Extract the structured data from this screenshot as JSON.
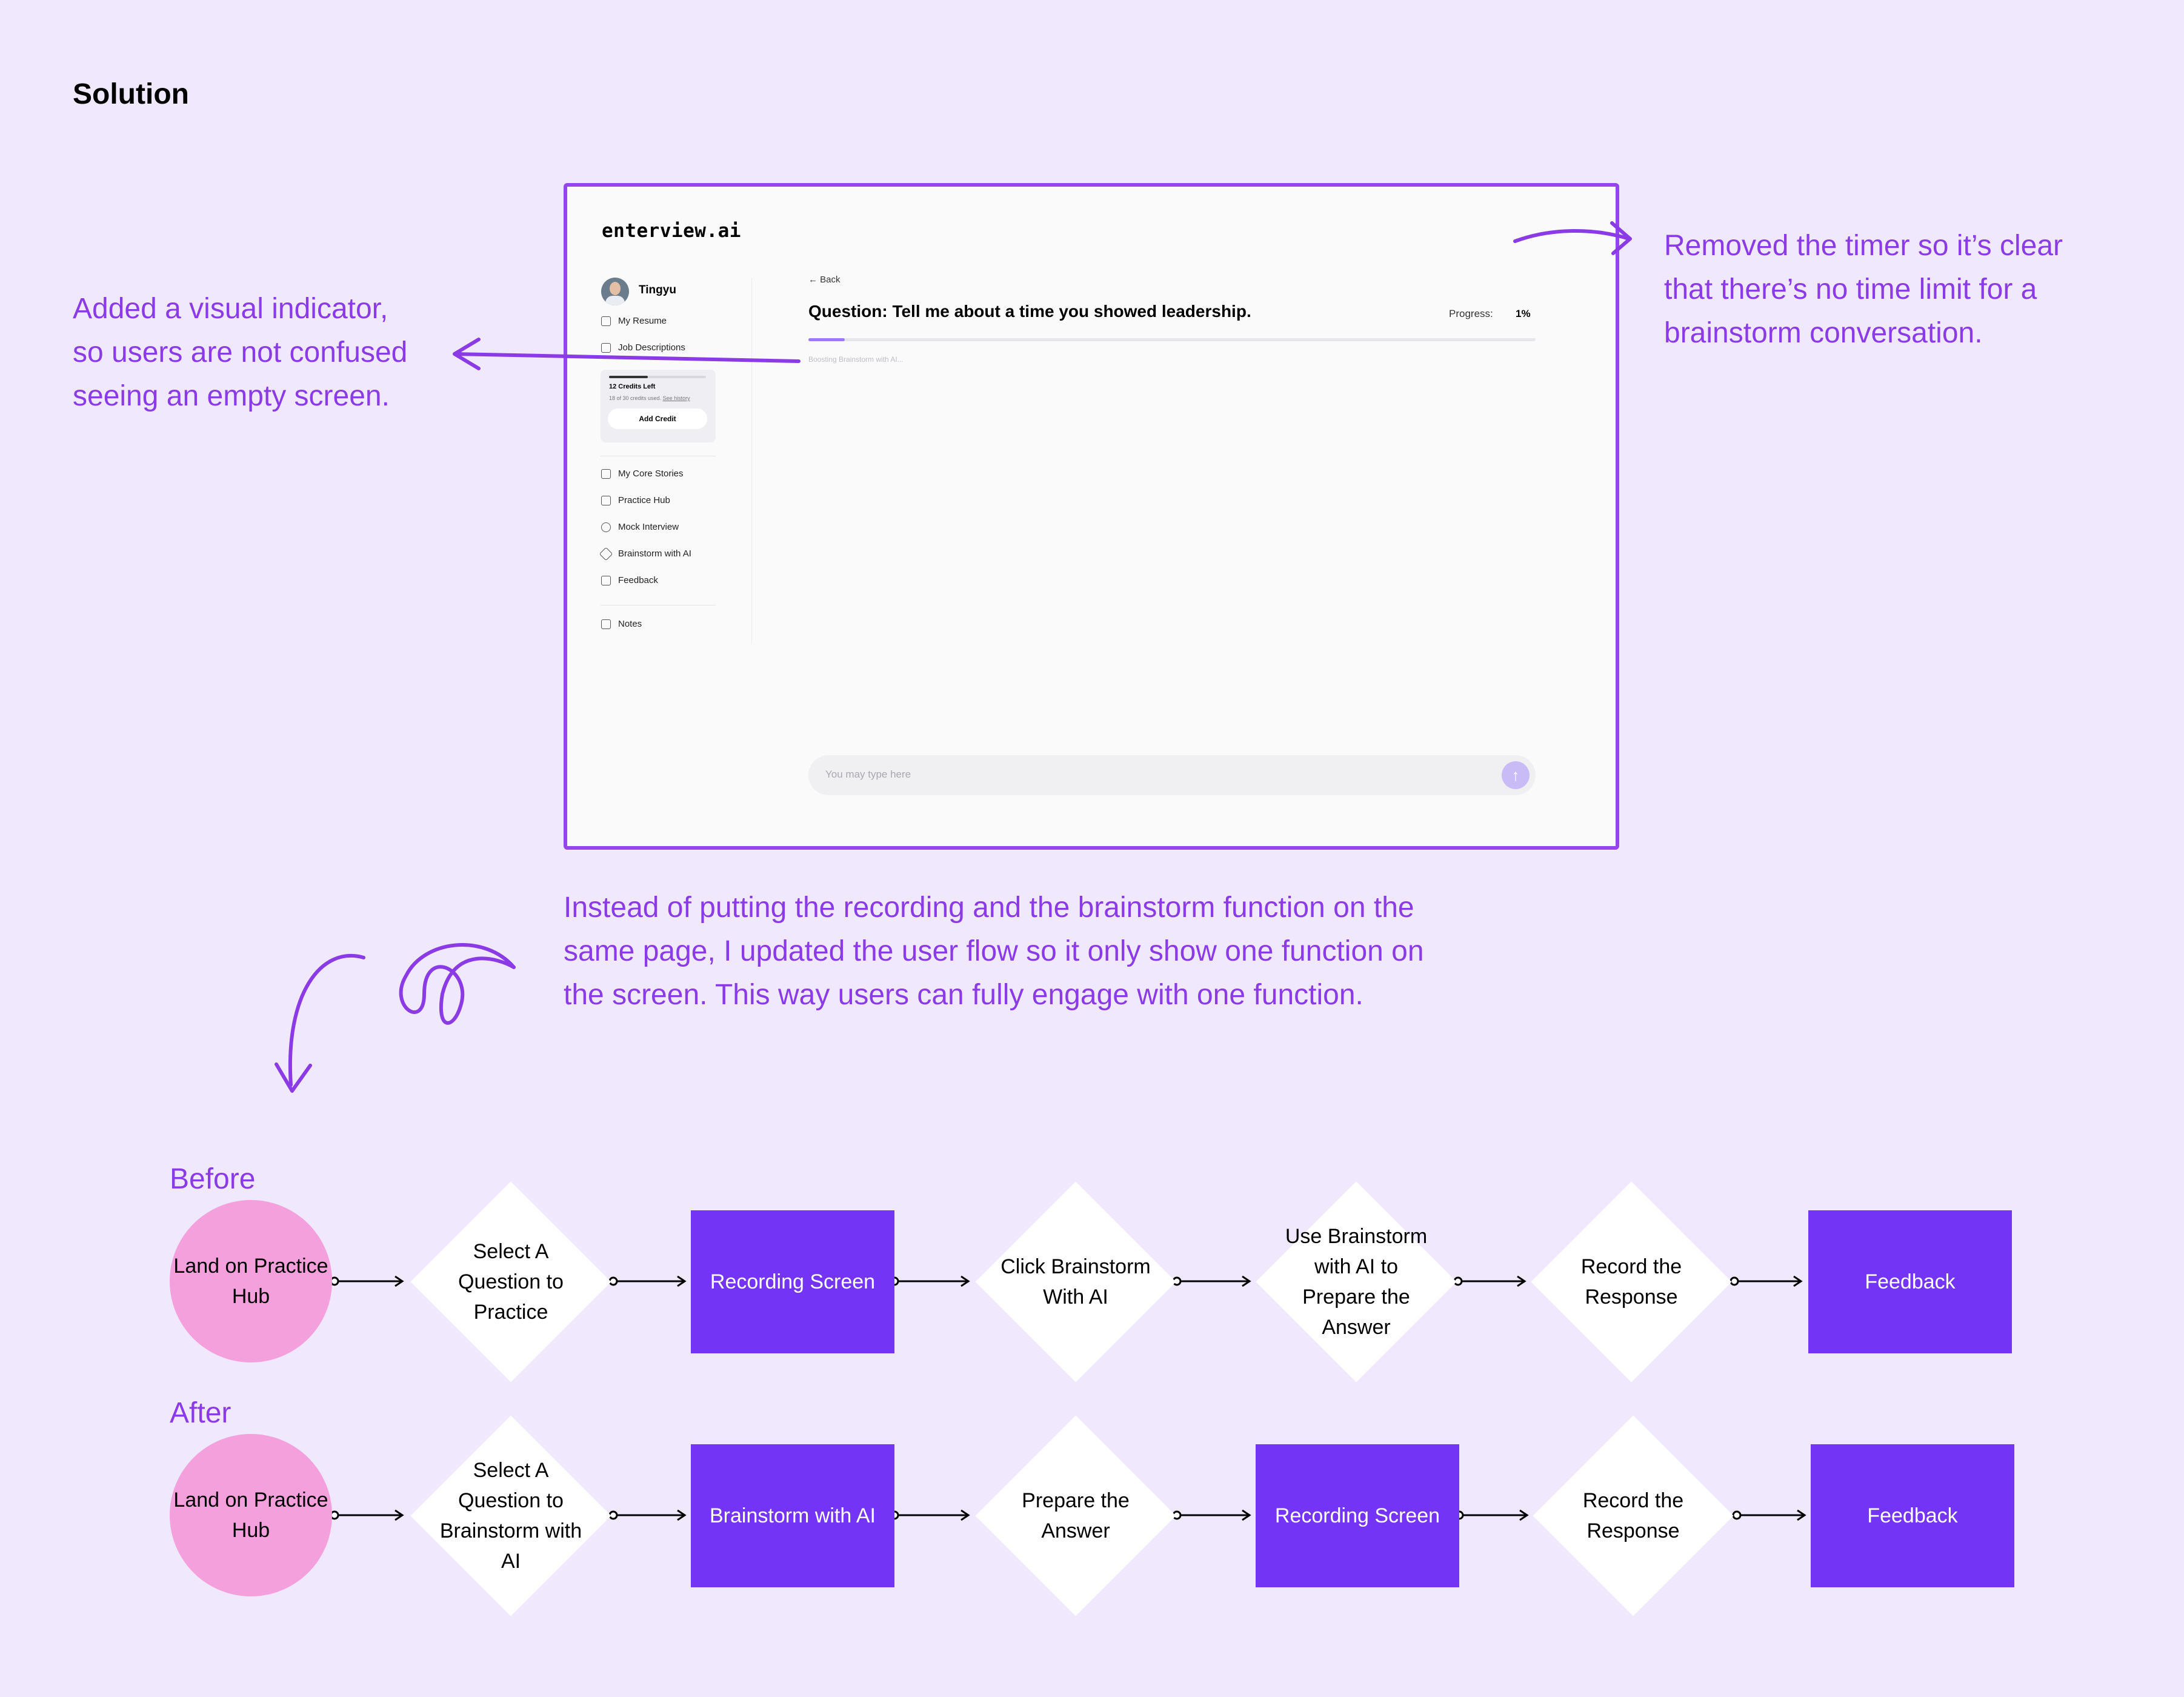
{
  "heading": "Solution",
  "notes": {
    "left": [
      "Added a visual indicator,",
      "so users are not confused",
      "seeing an empty screen."
    ],
    "right": [
      "Removed the timer so it’s clear",
      "that there’s no time limit for a",
      "brainstorm conversation."
    ],
    "middle": [
      "Instead of putting the recording and the brainstorm function on the",
      "same page, I updated the user flow so it only show one function on",
      "the screen. This way users can fully engage with one function."
    ]
  },
  "mockup": {
    "logo": "enterview.ai",
    "user": "Tingyu",
    "sidebar_top": [
      "My Resume",
      "Job Descriptions"
    ],
    "credits": {
      "title": "12 Credits Left",
      "sub": "18 of 30 credits used.",
      "link": "See history",
      "button": "Add Credit",
      "used_fraction": 0.4
    },
    "sidebar_main": [
      "My Core Stories",
      "Practice Hub",
      "Mock Interview",
      "Brainstorm with AI",
      "Feedback"
    ],
    "sidebar_bottom": [
      "Notes"
    ],
    "back": "Back",
    "question": "Question: Tell me about a time you showed leadership.",
    "progress_label": "Progress:",
    "progress_value": "1%",
    "progress_fraction": 0.05,
    "status": "Boosting Brainstorm with AI...",
    "input_placeholder": "You may type here"
  },
  "flows": {
    "before": {
      "label": "Before",
      "steps": [
        {
          "kind": "circle",
          "text": "Land on Practice Hub"
        },
        {
          "kind": "diamond",
          "text": "Select A Question to Practice"
        },
        {
          "kind": "rect",
          "text": "Recording Screen"
        },
        {
          "kind": "diamond",
          "text": "Click Brainstorm With AI"
        },
        {
          "kind": "diamond",
          "text": "Use Brainstorm with AI to Prepare the Answer"
        },
        {
          "kind": "diamond",
          "text": "Record the Response"
        },
        {
          "kind": "rect",
          "text": "Feedback"
        }
      ]
    },
    "after": {
      "label": "After",
      "steps": [
        {
          "kind": "circle",
          "text": "Land on Practice Hub"
        },
        {
          "kind": "diamond",
          "text": "Select A Question to Brainstorm with AI"
        },
        {
          "kind": "rect",
          "text": "Brainstorm with AI"
        },
        {
          "kind": "diamond",
          "text": "Prepare the Answer"
        },
        {
          "kind": "rect",
          "text": "Recording Screen"
        },
        {
          "kind": "diamond",
          "text": "Record the Response"
        },
        {
          "kind": "rect",
          "text": "Feedback"
        }
      ]
    }
  },
  "colors": {
    "background": "#F0E9FE",
    "accent": "#8A3BE6",
    "frame": "#9645EE",
    "rect": "#7334F6",
    "circle": "#F3A0DD"
  }
}
